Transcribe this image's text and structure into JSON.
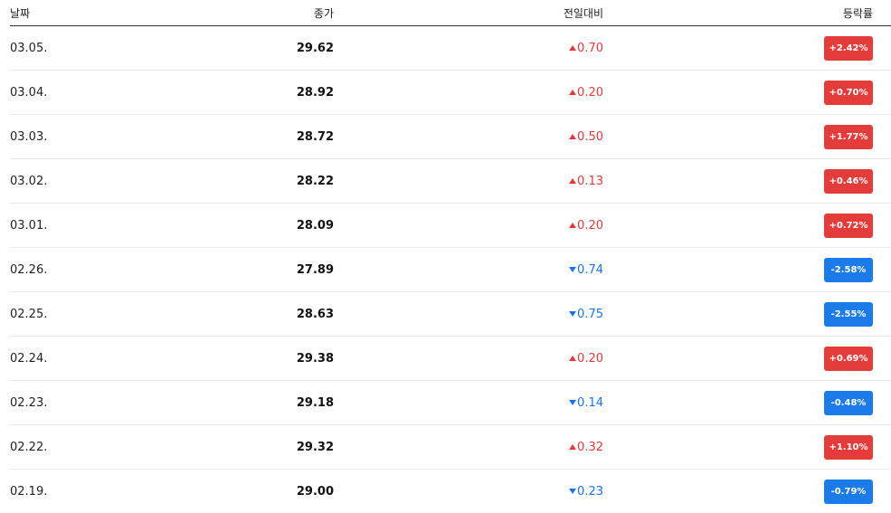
{
  "headers": {
    "date": "날짜",
    "close": "종가",
    "change": "전일대비",
    "rate": "등락률"
  },
  "colors": {
    "up": "#e43b3b",
    "down": "#1b7be8"
  },
  "rows": [
    {
      "date": "03.05.",
      "close": "29.62",
      "direction": "up",
      "change": "0.70",
      "rate": "+2.42%"
    },
    {
      "date": "03.04.",
      "close": "28.92",
      "direction": "up",
      "change": "0.20",
      "rate": "+0.70%"
    },
    {
      "date": "03.03.",
      "close": "28.72",
      "direction": "up",
      "change": "0.50",
      "rate": "+1.77%"
    },
    {
      "date": "03.02.",
      "close": "28.22",
      "direction": "up",
      "change": "0.13",
      "rate": "+0.46%"
    },
    {
      "date": "03.01.",
      "close": "28.09",
      "direction": "up",
      "change": "0.20",
      "rate": "+0.72%"
    },
    {
      "date": "02.26.",
      "close": "27.89",
      "direction": "down",
      "change": "0.74",
      "rate": "-2.58%"
    },
    {
      "date": "02.25.",
      "close": "28.63",
      "direction": "down",
      "change": "0.75",
      "rate": "-2.55%"
    },
    {
      "date": "02.24.",
      "close": "29.38",
      "direction": "up",
      "change": "0.20",
      "rate": "+0.69%"
    },
    {
      "date": "02.23.",
      "close": "29.18",
      "direction": "down",
      "change": "0.14",
      "rate": "-0.48%"
    },
    {
      "date": "02.22.",
      "close": "29.32",
      "direction": "up",
      "change": "0.32",
      "rate": "+1.10%"
    },
    {
      "date": "02.19.",
      "close": "29.00",
      "direction": "down",
      "change": "0.23",
      "rate": "-0.79%"
    }
  ]
}
